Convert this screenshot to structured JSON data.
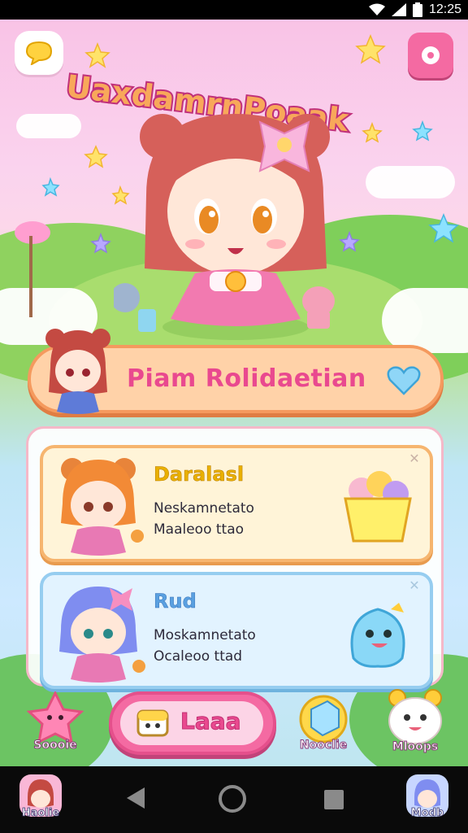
{
  "status_bar": {
    "time": "12:25",
    "icons": [
      "wifi-icon",
      "signal-icon",
      "battery-icon"
    ]
  },
  "header": {
    "title": "UaxdamrnPoaak",
    "chat_icon": "chat-bubble-icon",
    "settings_icon": "settings-icon"
  },
  "featured": {
    "label": "Piam Rolidaetian",
    "icon": "heart-icon"
  },
  "cards": [
    {
      "name": "Daralasl",
      "line1": "Neskamnetato",
      "line2": "Maaleoo ttao",
      "art": "cupcake-icon",
      "theme": "#f6b56f"
    },
    {
      "name": "Rud",
      "line1": "Moskamnetato",
      "line2": "Ocaleoo ttad",
      "art": "ghost-pet-icon",
      "theme": "#96cdf0"
    }
  ],
  "bottom_bar": {
    "left_label": "Soooie",
    "main_button_label": "Laaa",
    "right_item_label": "Nooclie",
    "far_right_label": "Mloops"
  },
  "nav_bar": {
    "left_app_label": "Haolie",
    "right_app_label": "Modb",
    "buttons": [
      "back-icon",
      "home-icon",
      "recent-apps-icon"
    ]
  },
  "colors": {
    "accent_pink": "#f46aa2",
    "banner_orange": "#f59a5e",
    "title_orange": "#f4a35a"
  }
}
